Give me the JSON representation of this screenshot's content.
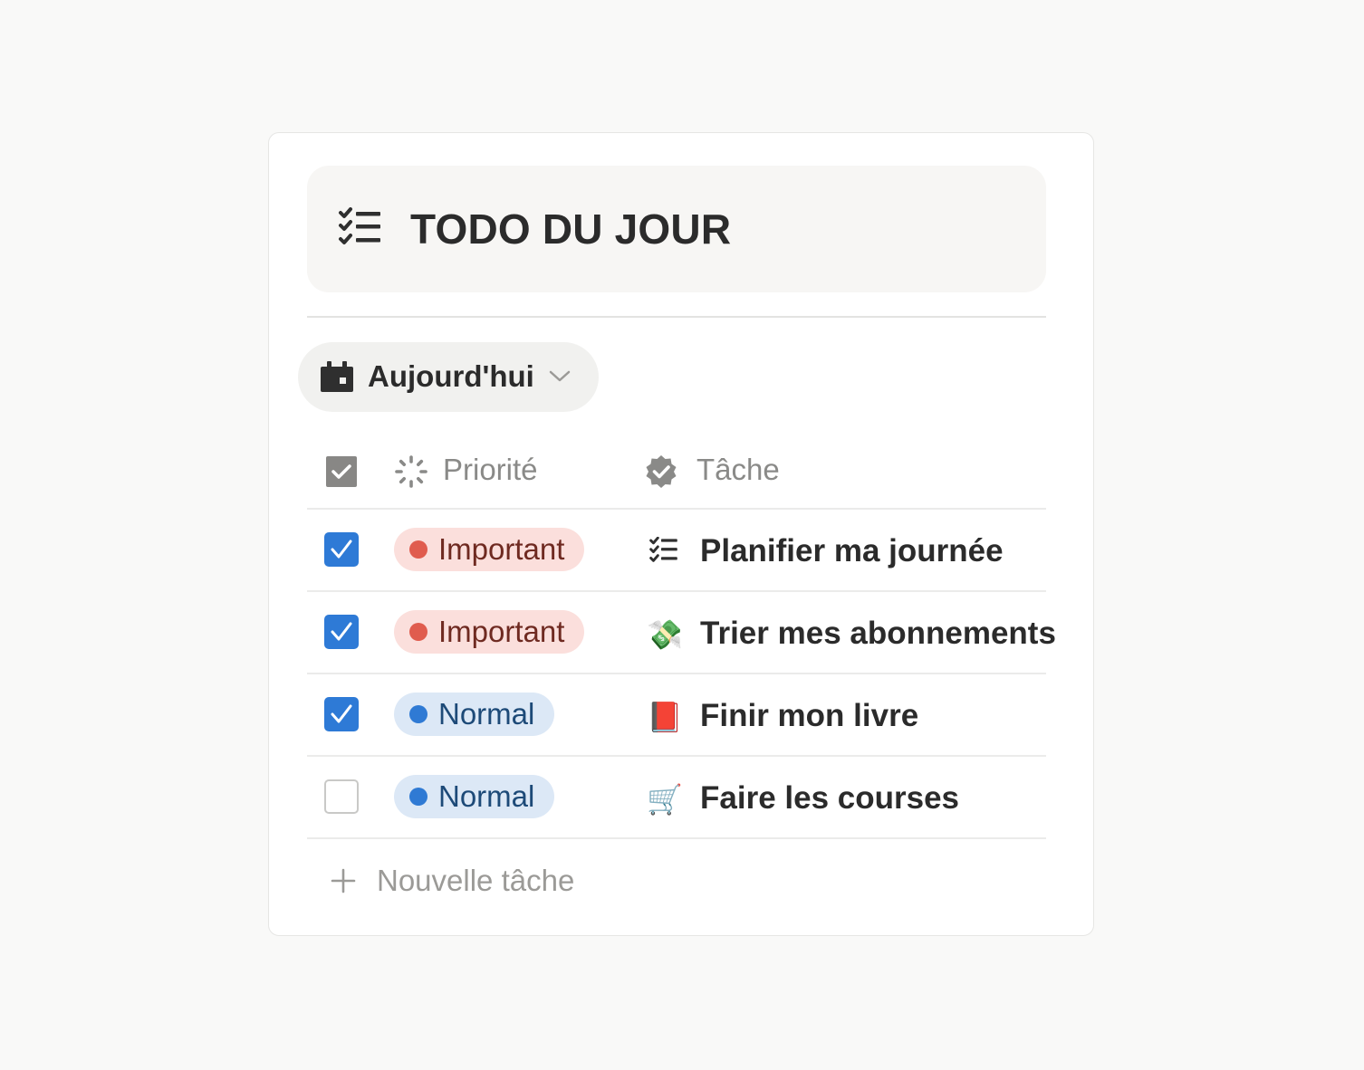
{
  "header": {
    "title": "TODO DU JOUR",
    "icon": "checklist-icon"
  },
  "filter": {
    "icon": "calendar-icon",
    "label": "Aujourd'hui",
    "chevron": "chevron-down-icon"
  },
  "columns": {
    "done": {
      "icon": "checkbox-icon"
    },
    "priority": {
      "icon": "loading-spinner-icon",
      "label": "Priorité"
    },
    "task": {
      "icon": "verified-badge-icon",
      "label": "Tâche"
    }
  },
  "rows": [
    {
      "checked": true,
      "priority": "Important",
      "priority_level": "important",
      "icon": "🗒",
      "icon_name": "checklist-icon",
      "task": "Planifier ma journée"
    },
    {
      "checked": true,
      "priority": "Important",
      "priority_level": "important",
      "icon": "💸",
      "icon_name": "money-wings-icon",
      "task": "Trier mes abonnements"
    },
    {
      "checked": true,
      "priority": "Normal",
      "priority_level": "normal",
      "icon": "📕",
      "icon_name": "red-book-icon",
      "task": "Finir mon livre"
    },
    {
      "checked": false,
      "priority": "Normal",
      "priority_level": "normal",
      "icon": "🛒",
      "icon_name": "shopping-cart-icon",
      "task": "Faire les courses"
    }
  ],
  "add_row": {
    "icon": "plus-icon",
    "label": "Nouvelle tâche"
  },
  "colors": {
    "checkbox_checked": "#2e7ad6",
    "important_bg": "#fbdfdc",
    "important_dot": "#e05c4e",
    "normal_bg": "#dce8f6",
    "normal_dot": "#2f7ad4"
  }
}
